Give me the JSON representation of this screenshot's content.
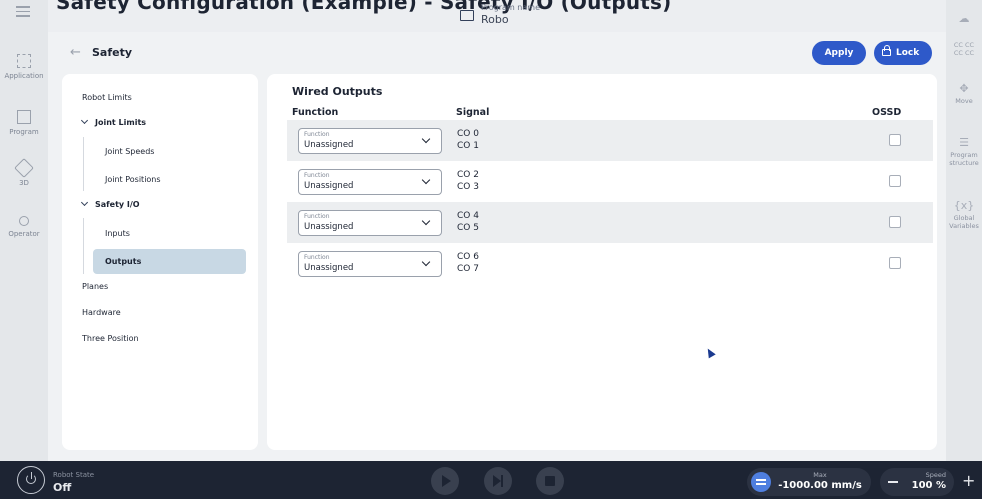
{
  "header": {
    "cut_title": "Safety Configuration (Example) - Safety I/O (Outputs)",
    "program_label": "Program name",
    "program_value": "Robo"
  },
  "left_nav": [
    {
      "label": "Application",
      "icon": "grid-icon"
    },
    {
      "label": "Program",
      "icon": "program-icon"
    },
    {
      "label": "3D",
      "icon": "cube-icon"
    },
    {
      "label": "Operator",
      "icon": "user-icon"
    }
  ],
  "right_nav": [
    {
      "label": "",
      "icon": "cloud-icon"
    },
    {
      "label": "CC CC\nCC CC",
      "icon": ""
    },
    {
      "label": "Move",
      "icon": "move-icon"
    },
    {
      "label": "Program\nstructure",
      "icon": "list-icon"
    },
    {
      "label": "Global\nVariables",
      "icon": "variables-icon"
    }
  ],
  "page": {
    "title": "Safety",
    "apply_label": "Apply",
    "lock_label": "Lock"
  },
  "side_menu": {
    "robot_limits": "Robot Limits",
    "joint_limits": "Joint Limits",
    "joint_speeds": "Joint Speeds",
    "joint_positions": "Joint Positions",
    "safety_io": "Safety I/O",
    "inputs": "Inputs",
    "outputs": "Outputs",
    "planes": "Planes",
    "hardware": "Hardware",
    "three_position": "Three Position"
  },
  "wired_outputs": {
    "title": "Wired Outputs",
    "col_function": "Function",
    "col_signal": "Signal",
    "col_ossd": "OSSD",
    "rows": [
      {
        "select_label": "Function",
        "select_value": "Unassigned",
        "signal_a": "CO 0",
        "signal_b": "CO 1",
        "ossd": false
      },
      {
        "select_label": "Function",
        "select_value": "Unassigned",
        "signal_a": "CO 2",
        "signal_b": "CO 3",
        "ossd": false
      },
      {
        "select_label": "Function",
        "select_value": "Unassigned",
        "signal_a": "CO 4",
        "signal_b": "CO 5",
        "ossd": false
      },
      {
        "select_label": "Function",
        "select_value": "Unassigned",
        "signal_a": "CO 6",
        "signal_b": "CO 7",
        "ossd": false
      }
    ]
  },
  "bottom_bar": {
    "robot_state_label": "Robot State",
    "robot_state_value": "Off",
    "max_label": "Max",
    "max_value": "-1000.00 mm/s",
    "speed_label": "Speed",
    "speed_value": "100 %"
  },
  "colors": {
    "accent": "#2e59c9",
    "bottom_bar": "#1d2433",
    "selected_menu": "#c8d8e4"
  }
}
